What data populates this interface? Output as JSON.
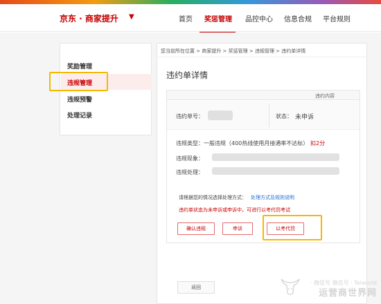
{
  "header": {
    "brand": "京东 · 商家提升",
    "brand_caret": "▼",
    "nav": [
      "首页",
      "奖惩管理",
      "品控中心",
      "信息合规",
      "平台规则"
    ]
  },
  "sidebar": {
    "items": [
      {
        "label": "奖励管理"
      },
      {
        "label": "违规管理"
      },
      {
        "label": "违规预警"
      },
      {
        "label": "处理记录"
      }
    ]
  },
  "breadcrumb": "您当前所在位置 > 商家提升 > 奖惩管理 > 违规管理 > 违约单详情",
  "title": "违约单详情",
  "section_title": "违约内容",
  "detail": {
    "order_no_label": "违约单号：",
    "status_label": "状态：",
    "status_value": "未申诉",
    "type_label": "违规类型：",
    "type_value": "一般违规（400热线使用月接通率不达标）",
    "deduct": "扣2分",
    "phenomenon_label": "违规现象：",
    "handling_label": "违规处理："
  },
  "notice": {
    "prefix": "请根据您的情况选择处理方式：",
    "link": "处理方式及规则说明",
    "warning": "违约单状态为未申诉或申诉中，可进行以考代罚考试"
  },
  "actions": {
    "confirm": "确认违规",
    "appeal": "申诉",
    "exam": "以考代罚"
  },
  "back": "返回",
  "watermark": {
    "line1": "· 微信号 微信号 · Telworld",
    "line2": "运营商世界网"
  },
  "colors": {
    "brand_red": "#c40000",
    "highlight": "#f5b800",
    "link_blue": "#1e6fd9"
  }
}
